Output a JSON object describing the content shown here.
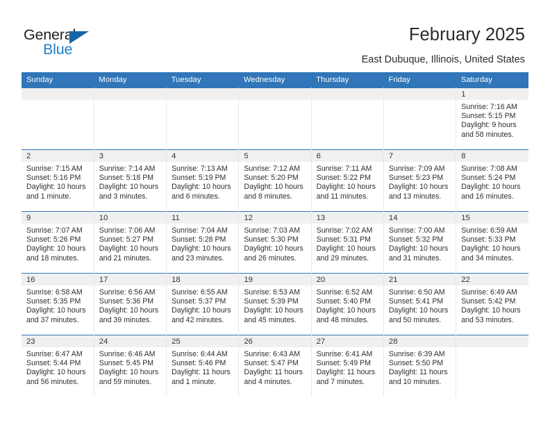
{
  "brand": {
    "name_top": "General",
    "name_bottom": "Blue",
    "color_dark": "#231f20",
    "color_blue": "#2081c8",
    "triangle_color": "#1565a8"
  },
  "header": {
    "title": "February 2025",
    "subtitle": "East Dubuque, Illinois, United States"
  },
  "theme": {
    "header_bg": "#3076b8",
    "daynum_band": "#f0f0f0",
    "row_border": "#3076b8"
  },
  "weekdays": [
    "Sunday",
    "Monday",
    "Tuesday",
    "Wednesday",
    "Thursday",
    "Friday",
    "Saturday"
  ],
  "weeks": [
    [
      {
        "day": "",
        "empty": true,
        "l1": "",
        "l2": "",
        "l3": "",
        "l4": ""
      },
      {
        "day": "",
        "empty": true,
        "l1": "",
        "l2": "",
        "l3": "",
        "l4": ""
      },
      {
        "day": "",
        "empty": true,
        "l1": "",
        "l2": "",
        "l3": "",
        "l4": ""
      },
      {
        "day": "",
        "empty": true,
        "l1": "",
        "l2": "",
        "l3": "",
        "l4": ""
      },
      {
        "day": "",
        "empty": true,
        "l1": "",
        "l2": "",
        "l3": "",
        "l4": ""
      },
      {
        "day": "",
        "empty": true,
        "l1": "",
        "l2": "",
        "l3": "",
        "l4": ""
      },
      {
        "day": "1",
        "empty": false,
        "l1": "Sunrise: 7:16 AM",
        "l2": "Sunset: 5:15 PM",
        "l3": "Daylight: 9 hours",
        "l4": "and 58 minutes."
      }
    ],
    [
      {
        "day": "2",
        "empty": false,
        "l1": "Sunrise: 7:15 AM",
        "l2": "Sunset: 5:16 PM",
        "l3": "Daylight: 10 hours",
        "l4": "and 1 minute."
      },
      {
        "day": "3",
        "empty": false,
        "l1": "Sunrise: 7:14 AM",
        "l2": "Sunset: 5:18 PM",
        "l3": "Daylight: 10 hours",
        "l4": "and 3 minutes."
      },
      {
        "day": "4",
        "empty": false,
        "l1": "Sunrise: 7:13 AM",
        "l2": "Sunset: 5:19 PM",
        "l3": "Daylight: 10 hours",
        "l4": "and 6 minutes."
      },
      {
        "day": "5",
        "empty": false,
        "l1": "Sunrise: 7:12 AM",
        "l2": "Sunset: 5:20 PM",
        "l3": "Daylight: 10 hours",
        "l4": "and 8 minutes."
      },
      {
        "day": "6",
        "empty": false,
        "l1": "Sunrise: 7:11 AM",
        "l2": "Sunset: 5:22 PM",
        "l3": "Daylight: 10 hours",
        "l4": "and 11 minutes."
      },
      {
        "day": "7",
        "empty": false,
        "l1": "Sunrise: 7:09 AM",
        "l2": "Sunset: 5:23 PM",
        "l3": "Daylight: 10 hours",
        "l4": "and 13 minutes."
      },
      {
        "day": "8",
        "empty": false,
        "l1": "Sunrise: 7:08 AM",
        "l2": "Sunset: 5:24 PM",
        "l3": "Daylight: 10 hours",
        "l4": "and 16 minutes."
      }
    ],
    [
      {
        "day": "9",
        "empty": false,
        "l1": "Sunrise: 7:07 AM",
        "l2": "Sunset: 5:26 PM",
        "l3": "Daylight: 10 hours",
        "l4": "and 18 minutes."
      },
      {
        "day": "10",
        "empty": false,
        "l1": "Sunrise: 7:06 AM",
        "l2": "Sunset: 5:27 PM",
        "l3": "Daylight: 10 hours",
        "l4": "and 21 minutes."
      },
      {
        "day": "11",
        "empty": false,
        "l1": "Sunrise: 7:04 AM",
        "l2": "Sunset: 5:28 PM",
        "l3": "Daylight: 10 hours",
        "l4": "and 23 minutes."
      },
      {
        "day": "12",
        "empty": false,
        "l1": "Sunrise: 7:03 AM",
        "l2": "Sunset: 5:30 PM",
        "l3": "Daylight: 10 hours",
        "l4": "and 26 minutes."
      },
      {
        "day": "13",
        "empty": false,
        "l1": "Sunrise: 7:02 AM",
        "l2": "Sunset: 5:31 PM",
        "l3": "Daylight: 10 hours",
        "l4": "and 29 minutes."
      },
      {
        "day": "14",
        "empty": false,
        "l1": "Sunrise: 7:00 AM",
        "l2": "Sunset: 5:32 PM",
        "l3": "Daylight: 10 hours",
        "l4": "and 31 minutes."
      },
      {
        "day": "15",
        "empty": false,
        "l1": "Sunrise: 6:59 AM",
        "l2": "Sunset: 5:33 PM",
        "l3": "Daylight: 10 hours",
        "l4": "and 34 minutes."
      }
    ],
    [
      {
        "day": "16",
        "empty": false,
        "l1": "Sunrise: 6:58 AM",
        "l2": "Sunset: 5:35 PM",
        "l3": "Daylight: 10 hours",
        "l4": "and 37 minutes."
      },
      {
        "day": "17",
        "empty": false,
        "l1": "Sunrise: 6:56 AM",
        "l2": "Sunset: 5:36 PM",
        "l3": "Daylight: 10 hours",
        "l4": "and 39 minutes."
      },
      {
        "day": "18",
        "empty": false,
        "l1": "Sunrise: 6:55 AM",
        "l2": "Sunset: 5:37 PM",
        "l3": "Daylight: 10 hours",
        "l4": "and 42 minutes."
      },
      {
        "day": "19",
        "empty": false,
        "l1": "Sunrise: 6:53 AM",
        "l2": "Sunset: 5:39 PM",
        "l3": "Daylight: 10 hours",
        "l4": "and 45 minutes."
      },
      {
        "day": "20",
        "empty": false,
        "l1": "Sunrise: 6:52 AM",
        "l2": "Sunset: 5:40 PM",
        "l3": "Daylight: 10 hours",
        "l4": "and 48 minutes."
      },
      {
        "day": "21",
        "empty": false,
        "l1": "Sunrise: 6:50 AM",
        "l2": "Sunset: 5:41 PM",
        "l3": "Daylight: 10 hours",
        "l4": "and 50 minutes."
      },
      {
        "day": "22",
        "empty": false,
        "l1": "Sunrise: 6:49 AM",
        "l2": "Sunset: 5:42 PM",
        "l3": "Daylight: 10 hours",
        "l4": "and 53 minutes."
      }
    ],
    [
      {
        "day": "23",
        "empty": false,
        "l1": "Sunrise: 6:47 AM",
        "l2": "Sunset: 5:44 PM",
        "l3": "Daylight: 10 hours",
        "l4": "and 56 minutes."
      },
      {
        "day": "24",
        "empty": false,
        "l1": "Sunrise: 6:46 AM",
        "l2": "Sunset: 5:45 PM",
        "l3": "Daylight: 10 hours",
        "l4": "and 59 minutes."
      },
      {
        "day": "25",
        "empty": false,
        "l1": "Sunrise: 6:44 AM",
        "l2": "Sunset: 5:46 PM",
        "l3": "Daylight: 11 hours",
        "l4": "and 1 minute."
      },
      {
        "day": "26",
        "empty": false,
        "l1": "Sunrise: 6:43 AM",
        "l2": "Sunset: 5:47 PM",
        "l3": "Daylight: 11 hours",
        "l4": "and 4 minutes."
      },
      {
        "day": "27",
        "empty": false,
        "l1": "Sunrise: 6:41 AM",
        "l2": "Sunset: 5:49 PM",
        "l3": "Daylight: 11 hours",
        "l4": "and 7 minutes."
      },
      {
        "day": "28",
        "empty": false,
        "l1": "Sunrise: 6:39 AM",
        "l2": "Sunset: 5:50 PM",
        "l3": "Daylight: 11 hours",
        "l4": "and 10 minutes."
      },
      {
        "day": "",
        "empty": true,
        "l1": "",
        "l2": "",
        "l3": "",
        "l4": ""
      }
    ]
  ]
}
